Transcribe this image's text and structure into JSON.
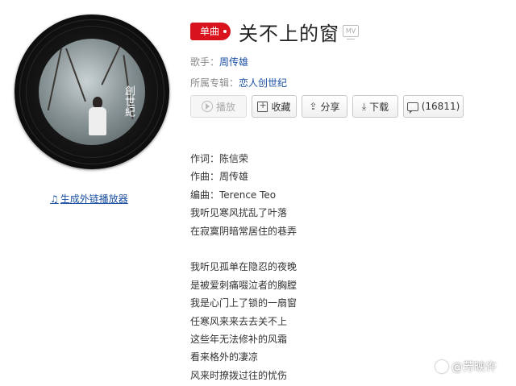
{
  "player": {
    "external_link_label": "生成外链播放器",
    "cover_text": "創世紀"
  },
  "song": {
    "type_badge": "单曲",
    "title": "关不上的窗",
    "mv_label": "MV",
    "artist_label": "歌手：",
    "artist": "周传雄",
    "album_label": "所属专辑：",
    "album": "恋人创世纪"
  },
  "actions": {
    "play": "播放",
    "favorite": "收藏",
    "share": "分享",
    "download": "下载",
    "comments": "(16811)"
  },
  "lyrics": [
    "作词：陈信荣",
    "作曲：周传雄",
    "编曲：Terence Teo",
    "我听见寒风扰乱了叶落",
    "在寂寞阴暗常居住的巷弄",
    "",
    "我听见孤单在隐忍的夜晚",
    "是被爱刺痛啜泣者的胸膛",
    "我是心门上了锁的一扇窗",
    "任寒风来来去去关不上",
    "这些年无法修补的风霜",
    "看来格外的凄凉",
    "风来时撩拨过往的忧伤"
  ],
  "watermark": "@芳映许",
  "colors": {
    "badge_red": "#d9131e",
    "link_blue": "#1a4fa3"
  }
}
